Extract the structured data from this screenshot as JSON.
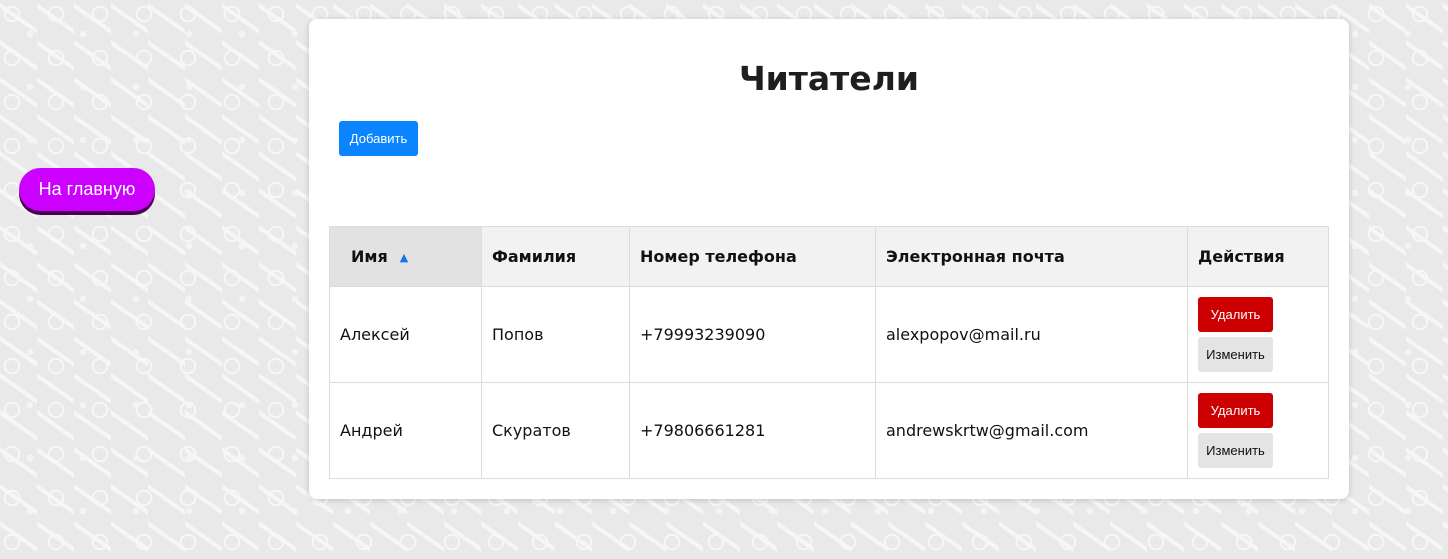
{
  "nav": {
    "home_label": "На главную"
  },
  "page": {
    "title": "Читатели",
    "add_label": "Добавить"
  },
  "table": {
    "headers": {
      "name": "Имя",
      "surname": "Фамилия",
      "phone": "Номер телефона",
      "email": "Электронная почта",
      "actions": "Действия"
    },
    "sort_indicator": "▲",
    "rows": [
      {
        "name": "Алексей",
        "surname": "Попов",
        "phone": "+79993239090",
        "email": "alexpopov@mail.ru",
        "delete_label": "Удалить",
        "edit_label": "Изменить"
      },
      {
        "name": "Андрей",
        "surname": "Скуратов",
        "phone": "+79806661281",
        "email": "andrewskrtw@gmail.com",
        "delete_label": "Удалить",
        "edit_label": "Изменить"
      }
    ]
  },
  "colors": {
    "home_button": "#cc00ff",
    "add_button": "#0a84ff",
    "delete_button": "#cc0000",
    "edit_button": "#e4e4e4",
    "sort_icon": "#1a73e8"
  },
  "icons": {
    "sort": "sort-ascending-icon"
  }
}
